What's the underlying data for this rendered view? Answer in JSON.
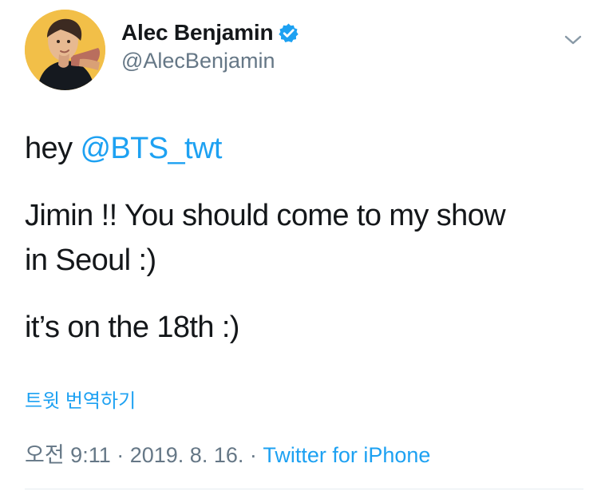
{
  "tweet": {
    "author": {
      "name": "Alec Benjamin",
      "handle": "@AlecBenjamin",
      "verified": true
    },
    "text": {
      "line1_prefix": "hey ",
      "line1_mention": "@BTS_twt",
      "line2": "Jimin !! You should come to my show",
      "line3": "in Seoul :)",
      "line4": "it’s on the 18th :)"
    },
    "translate_label": "트윗 번역하기",
    "meta": {
      "time": "오전 9:11",
      "separator1": " · ",
      "date": "2019. 8. 16.",
      "separator2": " · ",
      "source": "Twitter for iPhone"
    }
  },
  "icons": {
    "verified": "verified-badge-icon",
    "menu": "chevron-down-icon",
    "avatar": "avatar-image"
  },
  "colors": {
    "link": "#1da1f2",
    "secondary": "#657786",
    "primary": "#14171a",
    "avatar_background": "#f2bf48"
  }
}
